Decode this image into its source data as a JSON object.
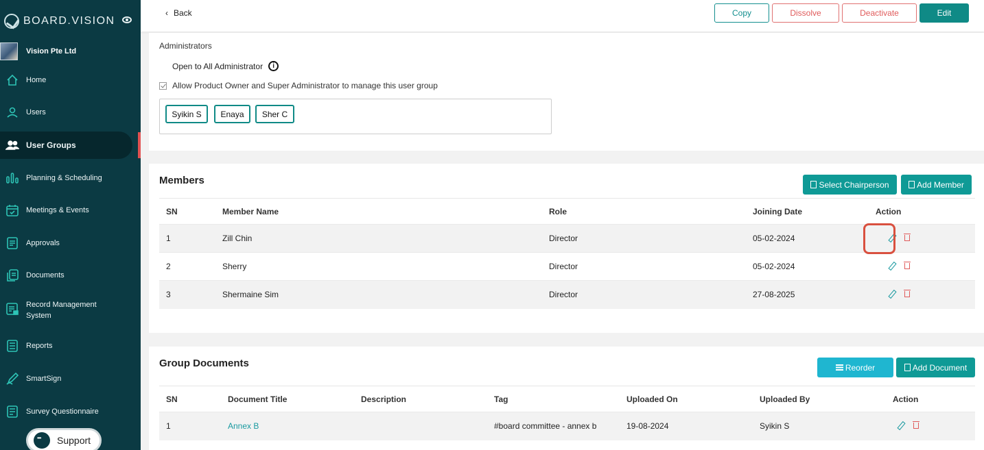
{
  "brand": {
    "name": "BOARD.VISION"
  },
  "org": {
    "name": "Vision Pte Ltd"
  },
  "sidebar": {
    "items": [
      {
        "label": "Home",
        "icon": "home-icon"
      },
      {
        "label": "Users",
        "icon": "user-icon"
      },
      {
        "label": "User Groups",
        "icon": "users-icon",
        "active": true
      },
      {
        "label": "Planning & Scheduling",
        "icon": "chart-bars-icon"
      },
      {
        "label": "Meetings & Events",
        "icon": "calendar-check-icon"
      },
      {
        "label": "Approvals",
        "icon": "document-list-icon"
      },
      {
        "label": "Documents",
        "icon": "documents-icon"
      },
      {
        "label": "Record Management System",
        "icon": "record-icon"
      },
      {
        "label": "Reports",
        "icon": "report-icon"
      },
      {
        "label": "SmartSign",
        "icon": "pen-icon"
      },
      {
        "label": "Survey Questionnaire",
        "icon": "survey-icon"
      }
    ],
    "support_label": "Support"
  },
  "toolbar": {
    "back_label": "Back",
    "copy_label": "Copy",
    "dissolve_label": "Dissolve",
    "deactivate_label": "Deactivate",
    "edit_label": "Edit"
  },
  "administrators": {
    "section_label": "Administrators",
    "open_label": "Open to All Administrator",
    "allow_label": "Allow Product Owner and Super Administrator to manage this user group",
    "chips": [
      "Syikin S",
      "Enaya",
      "Sher C"
    ]
  },
  "members": {
    "title": "Members",
    "select_chair_label": "Select Chairperson",
    "add_member_label": "Add Member",
    "columns": [
      "SN",
      "Member Name",
      "Role",
      "Joining Date",
      "Action"
    ],
    "rows": [
      {
        "sn": "1",
        "name": "Zill Chin",
        "role": "Director",
        "date": "05-02-2024"
      },
      {
        "sn": "2",
        "name": "Sherry",
        "role": "Director",
        "date": "05-02-2024"
      },
      {
        "sn": "3",
        "name": "Shermaine Sim",
        "role": "Director",
        "date": "27-08-2025"
      }
    ]
  },
  "documents": {
    "title": "Group Documents",
    "reorder_label": "Reorder",
    "add_document_label": "Add Document",
    "columns": [
      "SN",
      "Document Title",
      "Description",
      "Tag",
      "Uploaded On",
      "Uploaded By",
      "Action"
    ],
    "rows": [
      {
        "sn": "1",
        "title": "Annex B",
        "description": "",
        "tag": "#board committee - annex b",
        "uploaded_on": "19-08-2024",
        "uploaded_by": "Syikin S"
      }
    ]
  },
  "colors": {
    "sidebar_bg": "#0b3a43",
    "accent": "#0f8a86",
    "danger": "#e05a5a",
    "highlight": "#d9503f"
  }
}
